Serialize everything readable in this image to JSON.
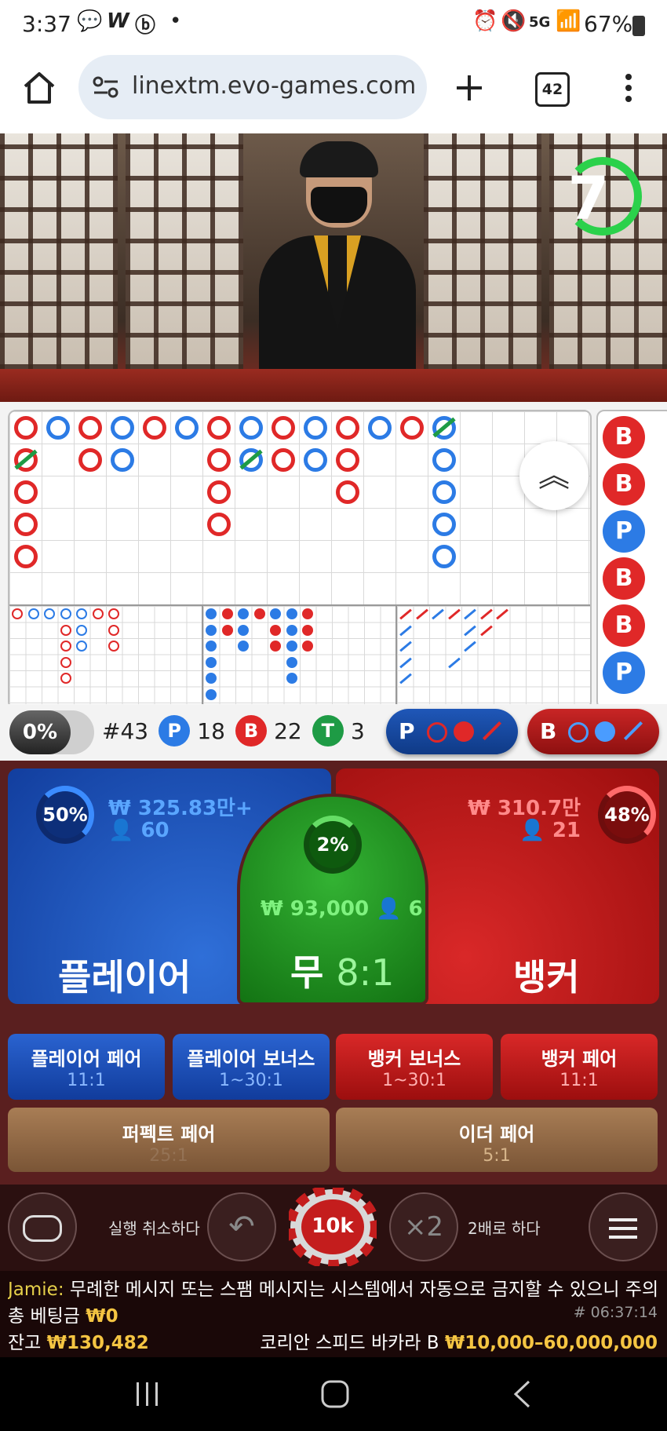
{
  "status_bar": {
    "time": "3:37",
    "left_icons": [
      "talk-icon",
      "w-icon",
      "b-icon",
      "dot-icon"
    ],
    "right_icons": [
      "alarm-icon",
      "mute-icon",
      "5g-icon",
      "signal-icon",
      "battery-icon"
    ],
    "battery": "67%"
  },
  "browser": {
    "url": "linextm.evo-games.com",
    "tab_count": "42"
  },
  "video": {
    "timer": "7",
    "timer_color": "#2bd14b"
  },
  "road": {
    "bead": [
      "B",
      "B",
      "P",
      "B",
      "B",
      "P"
    ]
  },
  "stats": {
    "percent": "0%",
    "round": "#43",
    "player_letter": "P",
    "player_count": "18",
    "banker_letter": "B",
    "banker_count": "22",
    "tie_letter": "T",
    "tie_count": "3",
    "predict_player": "P",
    "predict_banker": "B"
  },
  "betting": {
    "player": {
      "percent": "50%",
      "amount": "₩ 325.83만+",
      "users": "60",
      "title": "플레이어"
    },
    "tie": {
      "percent": "2%",
      "amount": "₩ 93,000",
      "users": "6",
      "title": "무",
      "payout": "8:1"
    },
    "banker": {
      "percent": "48%",
      "amount": "₩ 310.7만",
      "users": "21",
      "title": "뱅커"
    },
    "side_bets": [
      {
        "label": "플레이어 페어",
        "payout": "11:1"
      },
      {
        "label": "플레이어 보너스",
        "payout": "1~30:1"
      },
      {
        "label": "뱅커 보너스",
        "payout": "1~30:1"
      },
      {
        "label": "뱅커 페어",
        "payout": "11:1"
      }
    ],
    "perfect_pair": {
      "label": "퍼펙트 페어",
      "payout": "25:1"
    },
    "either_pair": {
      "label": "이더 페어",
      "payout": "5:1"
    }
  },
  "controls": {
    "undo_label": "실행 취소하다",
    "chip_value": "10k",
    "double_symbol": "×2",
    "double_label": "2배로 하다"
  },
  "chat": {
    "user": "Jamie:",
    "message": "무례한 메시지 또는 스팸 메시지는 시스템에서 자동으로 금지할 수 있으니 주의"
  },
  "info": {
    "total_bet_label": "총 베팅금",
    "total_bet_value": "₩0",
    "game_id": "# 06:37:14",
    "balance_label": "잔고",
    "balance_value": "₩130,482",
    "table_name": "코리안 스피드 바카라 B",
    "limits": "₩10,000–60,000,000"
  }
}
